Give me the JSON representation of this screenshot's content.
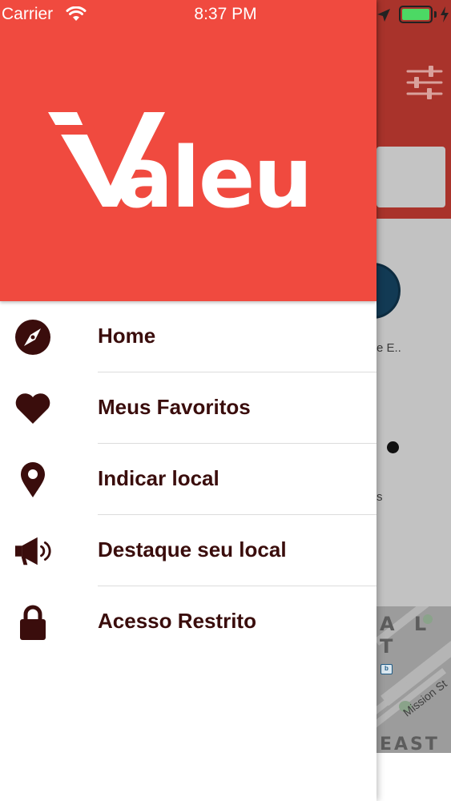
{
  "status_bar": {
    "carrier": "Carrier",
    "time": "8:37 PM",
    "battery_color": "#4cd964"
  },
  "background_app": {
    "header_color": "#a9332b",
    "card_label": "e E..",
    "partial_text": "s",
    "map": {
      "label_top": "A L",
      "label_second": "T",
      "street": "Mission St",
      "label_bottom": "EAST",
      "transit_badge": "b"
    }
  },
  "drawer": {
    "header_color": "#f04a3f",
    "logo_text": "aleu",
    "menu": [
      {
        "label": "Home",
        "icon": "compass-icon"
      },
      {
        "label": "Meus Favoritos",
        "icon": "heart-icon"
      },
      {
        "label": "Indicar local",
        "icon": "map-pin-icon"
      },
      {
        "label": "Destaque seu local",
        "icon": "megaphone-icon"
      },
      {
        "label": "Acesso Restrito",
        "icon": "lock-icon"
      }
    ],
    "text_color": "#3a0d0c"
  }
}
